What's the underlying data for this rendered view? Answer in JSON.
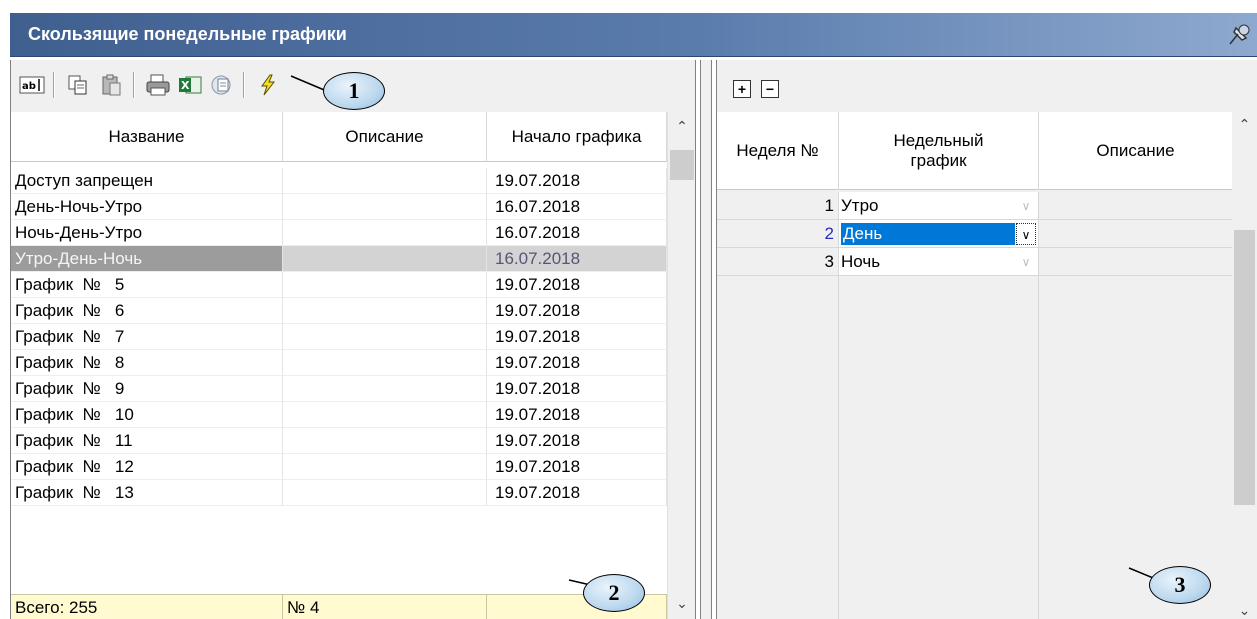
{
  "window": {
    "title": "Скользящие понедельные графики"
  },
  "left_toolbar": {
    "buttons": [
      "rename-icon",
      "copy-icon",
      "paste-icon",
      "print-icon",
      "excel-export-icon",
      "export-icon",
      "apply-lightning-icon"
    ],
    "callout_1": "1"
  },
  "schedules_table": {
    "columns": [
      "Название",
      "Описание",
      "Начало графика"
    ],
    "rows": [
      {
        "name": "Доступ запрещен",
        "description": "",
        "start": "19.07.2018"
      },
      {
        "name": "День-Ночь-Утро",
        "description": "",
        "start": "16.07.2018"
      },
      {
        "name": "Ночь-День-Утро",
        "description": "",
        "start": "16.07.2018"
      },
      {
        "name": "Утро-День-Ночь",
        "description": "",
        "start": "16.07.2018"
      },
      {
        "name": "График  №   5",
        "description": "",
        "start": "19.07.2018"
      },
      {
        "name": "График  №   6",
        "description": "",
        "start": "19.07.2018"
      },
      {
        "name": "График  №   7",
        "description": "",
        "start": "19.07.2018"
      },
      {
        "name": "График  №   8",
        "description": "",
        "start": "19.07.2018"
      },
      {
        "name": "График  №   9",
        "description": "",
        "start": "19.07.2018"
      },
      {
        "name": "График  №   10",
        "description": "",
        "start": "19.07.2018"
      },
      {
        "name": "График  №   11",
        "description": "",
        "start": "19.07.2018"
      },
      {
        "name": "График  №   12",
        "description": "",
        "start": "19.07.2018"
      },
      {
        "name": "График  №   13",
        "description": "",
        "start": "19.07.2018"
      }
    ],
    "selected_row": "Утро-День-Ночь",
    "footer": {
      "total": "Всего: 255",
      "current": "№ 4",
      "extra": ""
    },
    "callout_2": "2"
  },
  "right_toolbar": {
    "buttons": [
      "add-row-icon",
      "remove-row-icon"
    ]
  },
  "weeks_table": {
    "columns": [
      "Неделя №",
      "Недельный график",
      "Описание"
    ],
    "rows": [
      {
        "week": "1",
        "schedule": "Утро",
        "description": ""
      },
      {
        "week": "2",
        "schedule": "День",
        "description": ""
      },
      {
        "week": "3",
        "schedule": "Ночь",
        "description": ""
      }
    ],
    "active_row": "2",
    "callout_3": "3"
  },
  "colors": {
    "title_band": "#4a6a9b",
    "selection_blue": "#0078d7",
    "footer_yellow": "#fffad0",
    "callout_fill": "#bcd8ee"
  }
}
